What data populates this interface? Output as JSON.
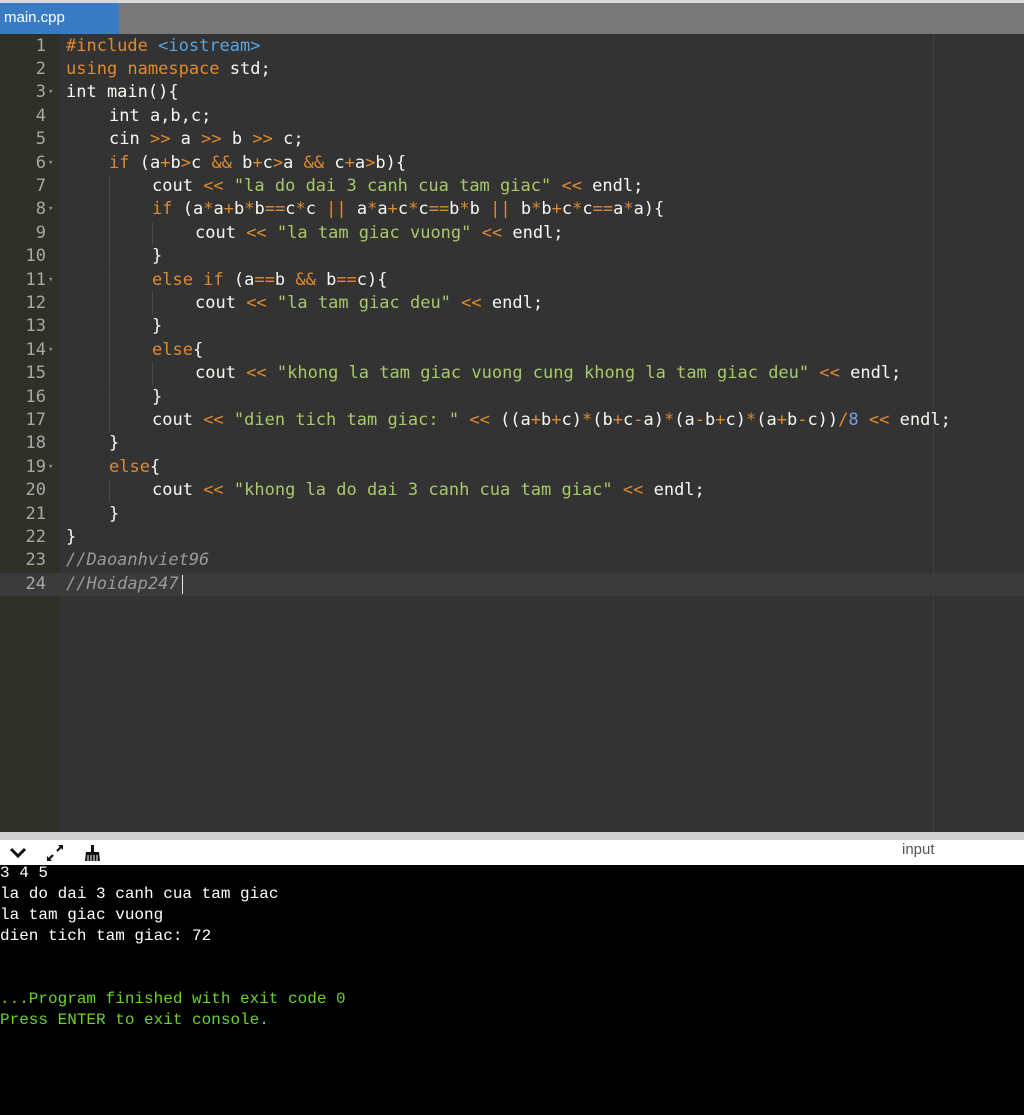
{
  "tab": {
    "label": "main.cpp"
  },
  "editor": {
    "lines": [
      {
        "n": "1",
        "indent": 0,
        "fold": false,
        "tokens": [
          {
            "t": "#include",
            "c": "kw"
          },
          {
            "t": " ",
            "c": "id"
          },
          {
            "t": "<iostream>",
            "c": "inc"
          }
        ]
      },
      {
        "n": "2",
        "indent": 0,
        "fold": false,
        "tokens": [
          {
            "t": "using namespace",
            "c": "kw"
          },
          {
            "t": " std;",
            "c": "id"
          }
        ]
      },
      {
        "n": "3",
        "indent": 0,
        "fold": true,
        "tokens": [
          {
            "t": "int main(){",
            "c": "id"
          }
        ]
      },
      {
        "n": "4",
        "indent": 1,
        "fold": false,
        "tokens": [
          {
            "t": "int a,b,c;",
            "c": "id"
          }
        ]
      },
      {
        "n": "5",
        "indent": 1,
        "fold": false,
        "tokens": [
          {
            "t": "cin ",
            "c": "id"
          },
          {
            "t": ">>",
            "c": "op"
          },
          {
            "t": " a ",
            "c": "id"
          },
          {
            "t": ">>",
            "c": "op"
          },
          {
            "t": " b ",
            "c": "id"
          },
          {
            "t": ">>",
            "c": "op"
          },
          {
            "t": " c;",
            "c": "id"
          }
        ]
      },
      {
        "n": "6",
        "indent": 1,
        "fold": true,
        "tokens": [
          {
            "t": "if",
            "c": "kw"
          },
          {
            "t": " (a",
            "c": "id"
          },
          {
            "t": "+",
            "c": "op"
          },
          {
            "t": "b",
            "c": "id"
          },
          {
            "t": ">",
            "c": "op"
          },
          {
            "t": "c ",
            "c": "id"
          },
          {
            "t": "&&",
            "c": "op"
          },
          {
            "t": " b",
            "c": "id"
          },
          {
            "t": "+",
            "c": "op"
          },
          {
            "t": "c",
            "c": "id"
          },
          {
            "t": ">",
            "c": "op"
          },
          {
            "t": "a ",
            "c": "id"
          },
          {
            "t": "&&",
            "c": "op"
          },
          {
            "t": " c",
            "c": "id"
          },
          {
            "t": "+",
            "c": "op"
          },
          {
            "t": "a",
            "c": "id"
          },
          {
            "t": ">",
            "c": "op"
          },
          {
            "t": "b){",
            "c": "id"
          }
        ]
      },
      {
        "n": "7",
        "indent": 2,
        "fold": false,
        "tokens": [
          {
            "t": "cout ",
            "c": "id"
          },
          {
            "t": "<<",
            "c": "op"
          },
          {
            "t": " ",
            "c": "id"
          },
          {
            "t": "\"la do dai 3 canh cua tam giac\"",
            "c": "str"
          },
          {
            "t": " ",
            "c": "id"
          },
          {
            "t": "<<",
            "c": "op"
          },
          {
            "t": " endl;",
            "c": "id"
          }
        ]
      },
      {
        "n": "8",
        "indent": 2,
        "fold": true,
        "tokens": [
          {
            "t": "if",
            "c": "kw"
          },
          {
            "t": " (a",
            "c": "id"
          },
          {
            "t": "*",
            "c": "op"
          },
          {
            "t": "a",
            "c": "id"
          },
          {
            "t": "+",
            "c": "op"
          },
          {
            "t": "b",
            "c": "id"
          },
          {
            "t": "*",
            "c": "op"
          },
          {
            "t": "b",
            "c": "id"
          },
          {
            "t": "==",
            "c": "op"
          },
          {
            "t": "c",
            "c": "id"
          },
          {
            "t": "*",
            "c": "op"
          },
          {
            "t": "c ",
            "c": "id"
          },
          {
            "t": "||",
            "c": "op"
          },
          {
            "t": " a",
            "c": "id"
          },
          {
            "t": "*",
            "c": "op"
          },
          {
            "t": "a",
            "c": "id"
          },
          {
            "t": "+",
            "c": "op"
          },
          {
            "t": "c",
            "c": "id"
          },
          {
            "t": "*",
            "c": "op"
          },
          {
            "t": "c",
            "c": "id"
          },
          {
            "t": "==",
            "c": "op"
          },
          {
            "t": "b",
            "c": "id"
          },
          {
            "t": "*",
            "c": "op"
          },
          {
            "t": "b ",
            "c": "id"
          },
          {
            "t": "||",
            "c": "op"
          },
          {
            "t": " b",
            "c": "id"
          },
          {
            "t": "*",
            "c": "op"
          },
          {
            "t": "b",
            "c": "id"
          },
          {
            "t": "+",
            "c": "op"
          },
          {
            "t": "c",
            "c": "id"
          },
          {
            "t": "*",
            "c": "op"
          },
          {
            "t": "c",
            "c": "id"
          },
          {
            "t": "==",
            "c": "op"
          },
          {
            "t": "a",
            "c": "id"
          },
          {
            "t": "*",
            "c": "op"
          },
          {
            "t": "a){",
            "c": "id"
          }
        ]
      },
      {
        "n": "9",
        "indent": 3,
        "fold": false,
        "tokens": [
          {
            "t": "cout ",
            "c": "id"
          },
          {
            "t": "<<",
            "c": "op"
          },
          {
            "t": " ",
            "c": "id"
          },
          {
            "t": "\"la tam giac vuong\"",
            "c": "str"
          },
          {
            "t": " ",
            "c": "id"
          },
          {
            "t": "<<",
            "c": "op"
          },
          {
            "t": " endl;",
            "c": "id"
          }
        ]
      },
      {
        "n": "10",
        "indent": 2,
        "fold": false,
        "tokens": [
          {
            "t": "}",
            "c": "id"
          }
        ]
      },
      {
        "n": "11",
        "indent": 2,
        "fold": true,
        "tokens": [
          {
            "t": "else if",
            "c": "kw"
          },
          {
            "t": " (a",
            "c": "id"
          },
          {
            "t": "==",
            "c": "op"
          },
          {
            "t": "b ",
            "c": "id"
          },
          {
            "t": "&&",
            "c": "op"
          },
          {
            "t": " b",
            "c": "id"
          },
          {
            "t": "==",
            "c": "op"
          },
          {
            "t": "c){",
            "c": "id"
          }
        ]
      },
      {
        "n": "12",
        "indent": 3,
        "fold": false,
        "tokens": [
          {
            "t": "cout ",
            "c": "id"
          },
          {
            "t": "<<",
            "c": "op"
          },
          {
            "t": " ",
            "c": "id"
          },
          {
            "t": "\"la tam giac deu\"",
            "c": "str"
          },
          {
            "t": " ",
            "c": "id"
          },
          {
            "t": "<<",
            "c": "op"
          },
          {
            "t": " endl;",
            "c": "id"
          }
        ]
      },
      {
        "n": "13",
        "indent": 2,
        "fold": false,
        "tokens": [
          {
            "t": "}",
            "c": "id"
          }
        ]
      },
      {
        "n": "14",
        "indent": 2,
        "fold": true,
        "tokens": [
          {
            "t": "else",
            "c": "kw"
          },
          {
            "t": "{",
            "c": "id"
          }
        ]
      },
      {
        "n": "15",
        "indent": 3,
        "fold": false,
        "tokens": [
          {
            "t": "cout ",
            "c": "id"
          },
          {
            "t": "<<",
            "c": "op"
          },
          {
            "t": " ",
            "c": "id"
          },
          {
            "t": "\"khong la tam giac vuong cung khong la tam giac deu\"",
            "c": "str"
          },
          {
            "t": " ",
            "c": "id"
          },
          {
            "t": "<<",
            "c": "op"
          },
          {
            "t": " endl;",
            "c": "id"
          }
        ]
      },
      {
        "n": "16",
        "indent": 2,
        "fold": false,
        "tokens": [
          {
            "t": "}",
            "c": "id"
          }
        ]
      },
      {
        "n": "17",
        "indent": 2,
        "fold": false,
        "tokens": [
          {
            "t": "cout ",
            "c": "id"
          },
          {
            "t": "<<",
            "c": "op"
          },
          {
            "t": " ",
            "c": "id"
          },
          {
            "t": "\"dien tich tam giac: \"",
            "c": "str"
          },
          {
            "t": " ",
            "c": "id"
          },
          {
            "t": "<<",
            "c": "op"
          },
          {
            "t": " ((a",
            "c": "id"
          },
          {
            "t": "+",
            "c": "op"
          },
          {
            "t": "b",
            "c": "id"
          },
          {
            "t": "+",
            "c": "op"
          },
          {
            "t": "c)",
            "c": "id"
          },
          {
            "t": "*",
            "c": "op"
          },
          {
            "t": "(b",
            "c": "id"
          },
          {
            "t": "+",
            "c": "op"
          },
          {
            "t": "c",
            "c": "id"
          },
          {
            "t": "-",
            "c": "op"
          },
          {
            "t": "a)",
            "c": "id"
          },
          {
            "t": "*",
            "c": "op"
          },
          {
            "t": "(a",
            "c": "id"
          },
          {
            "t": "-",
            "c": "op"
          },
          {
            "t": "b",
            "c": "id"
          },
          {
            "t": "+",
            "c": "op"
          },
          {
            "t": "c)",
            "c": "id"
          },
          {
            "t": "*",
            "c": "op"
          },
          {
            "t": "(a",
            "c": "id"
          },
          {
            "t": "+",
            "c": "op"
          },
          {
            "t": "b",
            "c": "id"
          },
          {
            "t": "-",
            "c": "op"
          },
          {
            "t": "c))",
            "c": "id"
          },
          {
            "t": "/",
            "c": "op"
          },
          {
            "t": "8",
            "c": "num"
          },
          {
            "t": " ",
            "c": "id"
          },
          {
            "t": "<<",
            "c": "op"
          },
          {
            "t": " endl;",
            "c": "id"
          }
        ]
      },
      {
        "n": "18",
        "indent": 1,
        "fold": false,
        "tokens": [
          {
            "t": "}",
            "c": "id"
          }
        ]
      },
      {
        "n": "19",
        "indent": 1,
        "fold": true,
        "tokens": [
          {
            "t": "else",
            "c": "kw"
          },
          {
            "t": "{",
            "c": "id"
          }
        ]
      },
      {
        "n": "20",
        "indent": 2,
        "fold": false,
        "tokens": [
          {
            "t": "cout ",
            "c": "id"
          },
          {
            "t": "<<",
            "c": "op"
          },
          {
            "t": " ",
            "c": "id"
          },
          {
            "t": "\"khong la do dai 3 canh cua tam giac\"",
            "c": "str"
          },
          {
            "t": " ",
            "c": "id"
          },
          {
            "t": "<<",
            "c": "op"
          },
          {
            "t": " endl;",
            "c": "id"
          }
        ]
      },
      {
        "n": "21",
        "indent": 1,
        "fold": false,
        "tokens": [
          {
            "t": "}",
            "c": "id"
          }
        ]
      },
      {
        "n": "22",
        "indent": 0,
        "fold": false,
        "tokens": [
          {
            "t": "}",
            "c": "id"
          }
        ]
      },
      {
        "n": "23",
        "indent": 0,
        "fold": false,
        "tokens": [
          {
            "t": "//Daoanhviet96",
            "c": "cm"
          }
        ]
      },
      {
        "n": "24",
        "indent": 0,
        "fold": false,
        "tokens": [
          {
            "t": "//Hoidap247",
            "c": "cm"
          }
        ]
      }
    ]
  },
  "console_toolbar": {
    "icons": [
      "chevron-down-icon",
      "expand-icon",
      "clear-console-icon"
    ],
    "input_label": "input"
  },
  "console": {
    "lines": [
      {
        "text": "3 4 5",
        "color": "white"
      },
      {
        "text": "la do dai 3 canh cua tam giac",
        "color": "white"
      },
      {
        "text": "la tam giac vuong",
        "color": "white"
      },
      {
        "text": "dien tich tam giac: 72",
        "color": "white"
      },
      {
        "text": "",
        "color": "white"
      },
      {
        "text": "",
        "color": "white"
      },
      {
        "text": "...Program finished with exit code 0",
        "color": "green"
      },
      {
        "text": "Press ENTER to exit console.",
        "color": "green"
      }
    ]
  },
  "colors": {
    "tab_active": "#3a7cc4",
    "editor_bg": "#333333",
    "keyword": "#e08a2f",
    "string": "#a8c96a",
    "console_finish": "#6ad32a"
  }
}
